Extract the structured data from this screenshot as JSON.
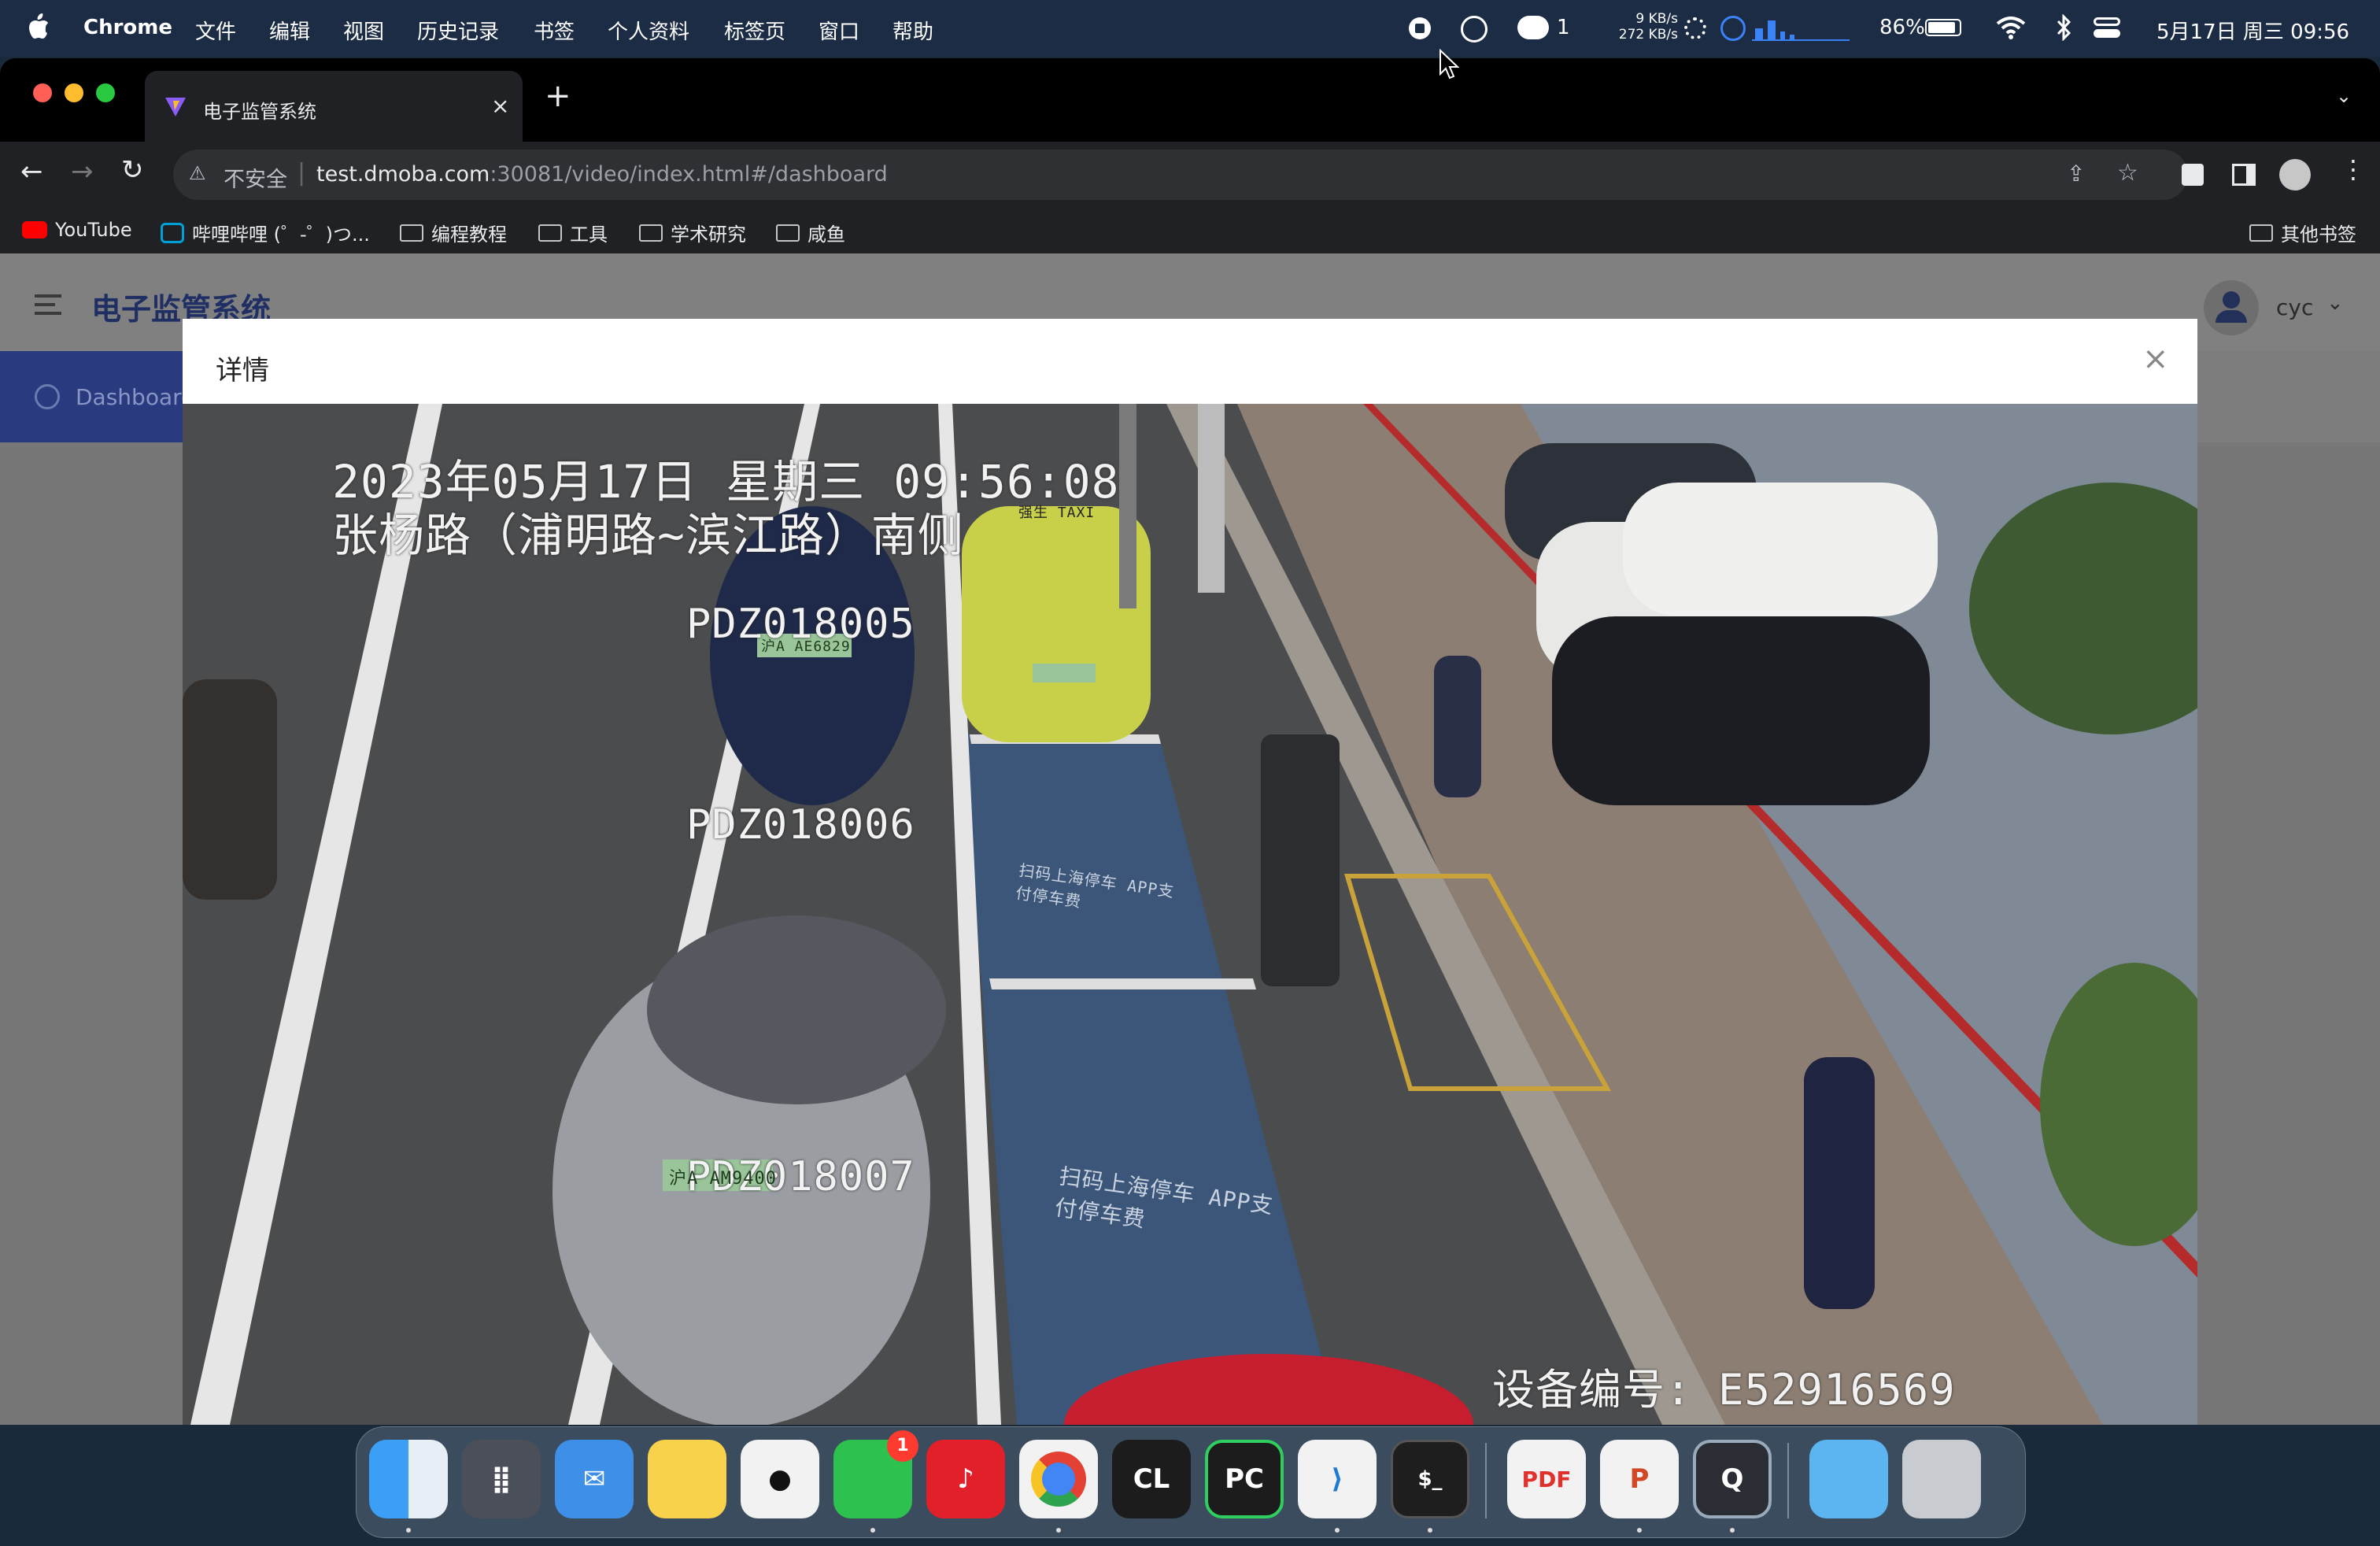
{
  "menubar": {
    "app_name": "Chrome",
    "items": [
      "文件",
      "编辑",
      "视图",
      "历史记录",
      "书签",
      "个人资料",
      "标签页",
      "窗口",
      "帮助"
    ],
    "wechat_count": "1",
    "net_up": "9 KB/s",
    "net_down": "272 KB/s",
    "battery": "86%",
    "datetime": "5月17日 周三 09:56"
  },
  "browser": {
    "tab_title": "电子监管系统",
    "security_label": "不安全",
    "url_host": "test.dmoba.com",
    "url_rest": ":30081/video/index.html#/dashboard",
    "bookmarks": [
      "YouTube",
      "哔哩哔哩 (゜-゜)つ...",
      "编程教程",
      "工具",
      "学术研究",
      "咸鱼"
    ],
    "other_bookmarks": "其他书签"
  },
  "app": {
    "title": "电子监管系统",
    "user": "cyc",
    "nav_item": "Dashboard"
  },
  "modal": {
    "title": "详情",
    "video": {
      "timestamp": "2023年05月17日 星期三 09:56:08",
      "location": "张杨路（浦明路~滨江路）南侧",
      "spots": [
        "PDZ018005",
        "PDZ018006",
        "PDZ018007"
      ],
      "device_id": "设备编号: E52916569",
      "plate_1": "沪A AE6829",
      "plate_2": "沪A AM9400",
      "taxi_sign": "强生 TAXI",
      "road_text_1": "扫码上海停车 APP支付停车费",
      "road_text_2": "扫码上海停车 APP支付停车费"
    }
  },
  "dock": {
    "apps": [
      "Finder",
      "Launchpad",
      "Mail",
      "Notes",
      "QQ",
      "WeChat",
      "NetEase Music",
      "Chrome",
      "CLion",
      "PyCharm",
      "VS Code",
      "Terminal",
      "PDF Expert",
      "PowerPoint",
      "QuickTime",
      "Folder",
      "Trash"
    ],
    "wechat_badge": "1"
  },
  "colors": {
    "accent": "#2a3a7e",
    "mac_red": "#ff5f57",
    "mac_yellow": "#febc2e",
    "mac_green": "#28c840"
  }
}
